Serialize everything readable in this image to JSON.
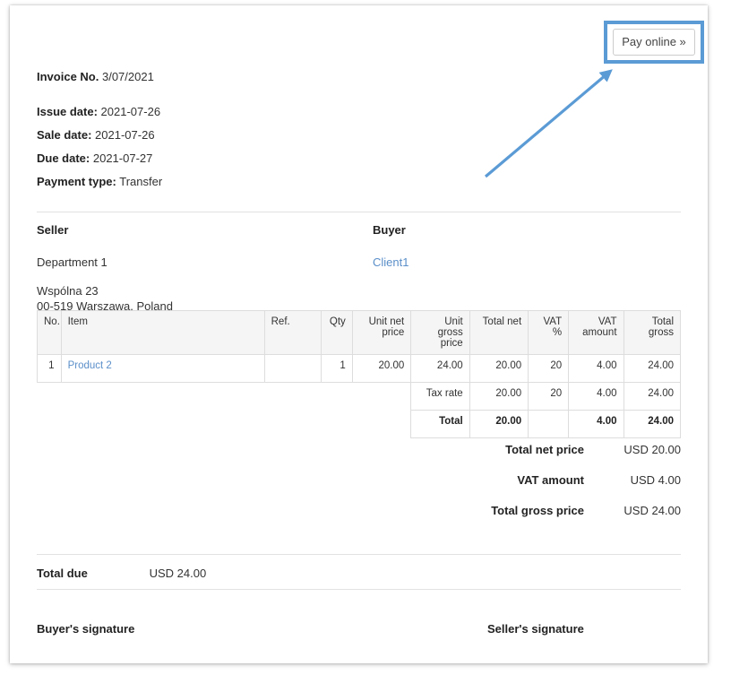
{
  "action": {
    "pay_online_label": "Pay online »"
  },
  "annotation": {
    "arrow_color": "#5b9bd5",
    "highlight_color": "#5b9bd5"
  },
  "meta": {
    "invoice_no_label": "Invoice No.",
    "invoice_no_value": "3/07/2021",
    "issue_date_label": "Issue date:",
    "issue_date_value": "2021-07-26",
    "sale_date_label": "Sale date:",
    "sale_date_value": "2021-07-26",
    "due_date_label": "Due date:",
    "due_date_value": "2021-07-27",
    "payment_type_label": "Payment type:",
    "payment_type_value": "Transfer"
  },
  "parties": {
    "seller": {
      "title": "Seller",
      "name": "Department 1",
      "address_line1": "Wspólna 23",
      "address_line2": "00-519 Warszawa, Poland"
    },
    "buyer": {
      "title": "Buyer",
      "name": "Client1",
      "link_color": "#5b8fc9"
    }
  },
  "items_table": {
    "headers": {
      "no": "No.",
      "item": "Item",
      "ref": "Ref.",
      "qty": "Qty",
      "unit_net_price": "Unit net price",
      "unit_gross_price": "Unit gross price",
      "total_net": "Total net",
      "vat_percent": "VAT %",
      "vat_amount": "VAT amount",
      "total_gross": "Total gross"
    },
    "rows": [
      {
        "no": "1",
        "item": "Product 2",
        "ref": "",
        "qty": "1",
        "unit_net_price": "20.00",
        "unit_gross_price": "24.00",
        "total_net": "20.00",
        "vat_percent": "20",
        "vat_amount": "4.00",
        "total_gross": "24.00"
      }
    ],
    "tax_rate_row": {
      "label": "Tax rate",
      "total_net": "20.00",
      "vat_percent": "20",
      "vat_amount": "4.00",
      "total_gross": "24.00"
    },
    "total_row": {
      "label": "Total",
      "total_net": "20.00",
      "vat_percent": "",
      "vat_amount": "4.00",
      "total_gross": "24.00"
    }
  },
  "summary": {
    "total_net_price_label": "Total net price",
    "total_net_price_value": "USD 20.00",
    "vat_amount_label": "VAT amount",
    "vat_amount_value": "USD 4.00",
    "total_gross_price_label": "Total gross price",
    "total_gross_price_value": "USD 24.00"
  },
  "total_due": {
    "label": "Total due",
    "value": "USD 24.00"
  },
  "signatures": {
    "buyer": "Buyer's signature",
    "seller": "Seller's signature"
  }
}
